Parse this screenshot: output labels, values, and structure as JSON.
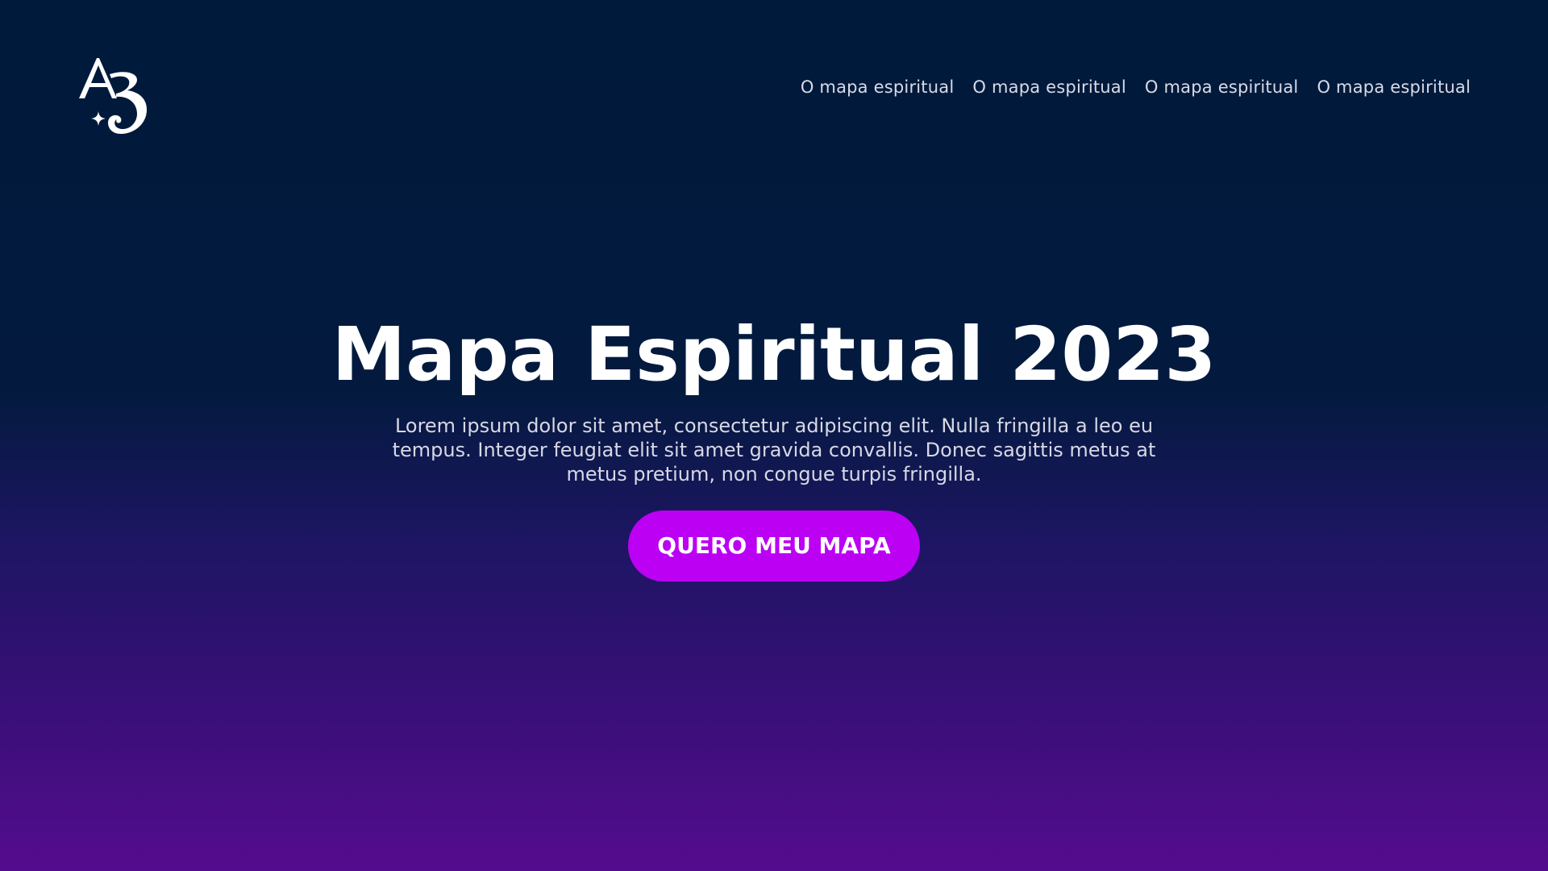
{
  "logo": {
    "text": "A3",
    "icon": "sparkle-icon"
  },
  "nav": {
    "items": [
      {
        "label": "O mapa espiritual"
      },
      {
        "label": "O mapa espiritual"
      },
      {
        "label": "O mapa espiritual"
      },
      {
        "label": "O mapa espiritual"
      }
    ]
  },
  "hero": {
    "title": "Mapa Espiritual 2023",
    "description": "Lorem ipsum dolor sit amet, consectetur adipiscing elit. Nulla fringilla a leo eu tempus. Integer feugiat elit sit amet gravida convallis. Donec sagittis metus at metus pretium, non congue turpis fringilla.",
    "cta_label": "QUERO MEU MAPA"
  },
  "colors": {
    "background_top": "#001a3b",
    "background_bottom": "#540c8e",
    "accent": "#bb00f4",
    "text": "#ffffff"
  }
}
